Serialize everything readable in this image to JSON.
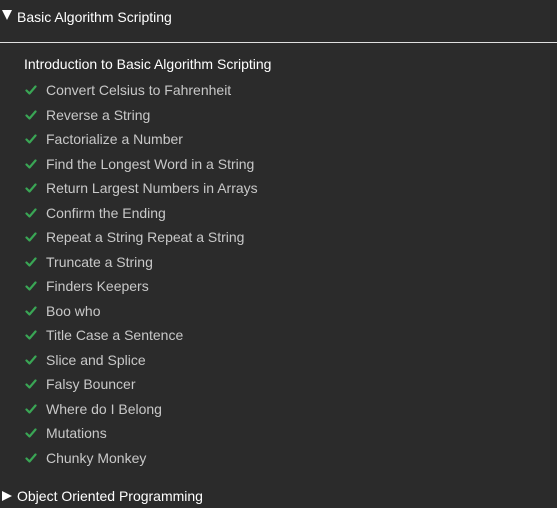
{
  "section": {
    "title": "Basic Algorithm Scripting",
    "expanded": true
  },
  "subsection": {
    "title": "Introduction to Basic Algorithm Scripting"
  },
  "check_color": "#3aa655",
  "items": [
    {
      "label": "Convert Celsius to Fahrenheit",
      "completed": true
    },
    {
      "label": "Reverse a String",
      "completed": true
    },
    {
      "label": "Factorialize a Number",
      "completed": true
    },
    {
      "label": "Find the Longest Word in a String",
      "completed": true
    },
    {
      "label": "Return Largest Numbers in Arrays",
      "completed": true
    },
    {
      "label": "Confirm the Ending",
      "completed": true
    },
    {
      "label": "Repeat a String Repeat a String",
      "completed": true
    },
    {
      "label": "Truncate a String",
      "completed": true
    },
    {
      "label": "Finders Keepers",
      "completed": true
    },
    {
      "label": "Boo who",
      "completed": true
    },
    {
      "label": "Title Case a Sentence",
      "completed": true
    },
    {
      "label": "Slice and Splice",
      "completed": true
    },
    {
      "label": "Falsy Bouncer",
      "completed": true
    },
    {
      "label": "Where do I Belong",
      "completed": true
    },
    {
      "label": "Mutations",
      "completed": true
    },
    {
      "label": "Chunky Monkey",
      "completed": true
    }
  ],
  "next_section": {
    "title": "Object Oriented Programming",
    "expanded": false
  }
}
